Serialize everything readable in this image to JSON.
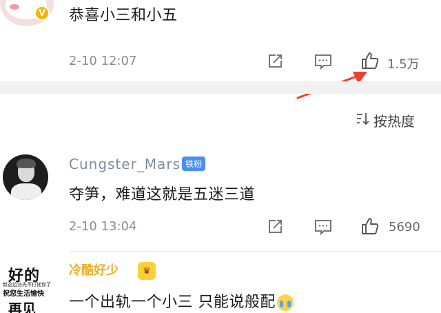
{
  "comments": [
    {
      "text": "恭喜小三和小五",
      "time": "2-10 12:07",
      "likes": "1.5万",
      "badge": "V"
    },
    {
      "username": "Cungster_Mars",
      "fan_badge": "铁粉",
      "text": "夺笋，难道这就是五迷三道",
      "time": "2-10 13:04",
      "likes": "5690"
    },
    {
      "username": "冷酷好少",
      "text": "一个出轨一个小三 只能说般配",
      "avatar_text": [
        "好的",
        "新这边派先不打扰你了",
        "祝您生活愉快",
        "再见"
      ]
    }
  ],
  "sort": {
    "label": "按热度"
  },
  "colors": {
    "arrow": "#e8432d",
    "badge_blue": "#4c8df6",
    "verified": "#f7b500"
  }
}
